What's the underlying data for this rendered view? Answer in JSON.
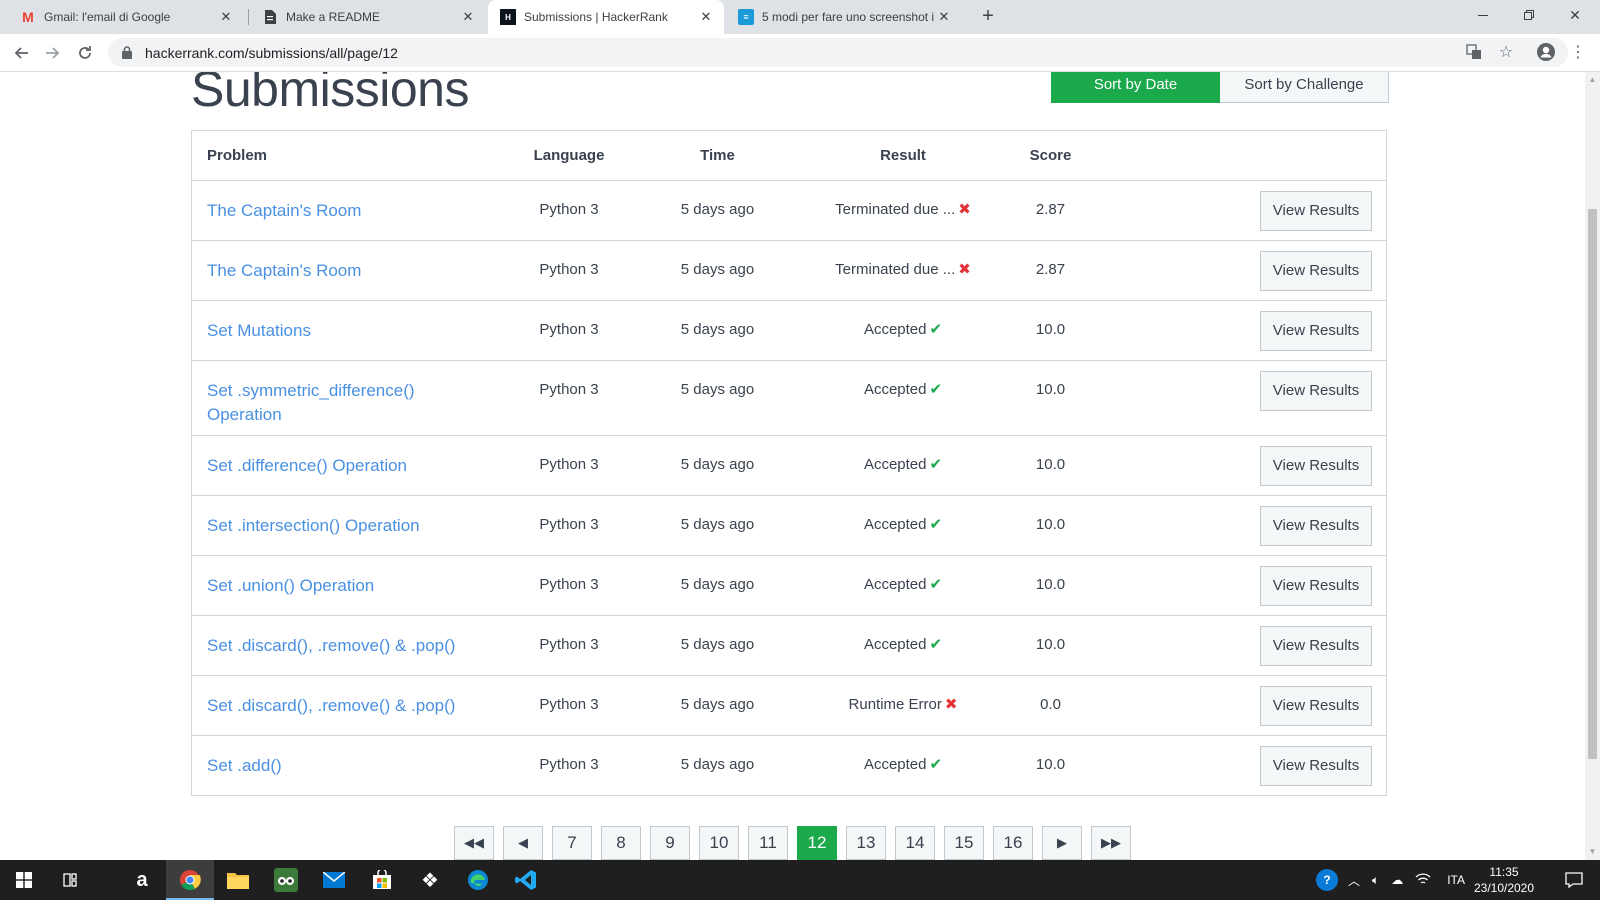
{
  "browser": {
    "tabs": [
      {
        "title": "Gmail: l'email di Google",
        "icon": "gmail-icon",
        "active": false
      },
      {
        "title": "Make a README",
        "icon": "document-icon",
        "active": false
      },
      {
        "title": "Submissions | HackerRank",
        "icon": "hackerrank-icon",
        "active": true
      },
      {
        "title": "5 modi per fare uno screenshot i",
        "icon": "docs-icon",
        "active": false
      }
    ],
    "url": "hackerrank.com/submissions/all/page/12"
  },
  "page": {
    "title": "Submissions",
    "sort_by_date": "Sort by Date",
    "sort_by_challenge": "Sort by Challenge"
  },
  "table": {
    "headers": {
      "problem": "Problem",
      "language": "Language",
      "time": "Time",
      "result": "Result",
      "score": "Score"
    },
    "rows": [
      {
        "problem": "The Captain's Room",
        "language": "Python 3",
        "time": "5 days ago",
        "result": "Terminated due ...",
        "status": "error",
        "score": "2.87",
        "action": "View Results"
      },
      {
        "problem": "The Captain's Room",
        "language": "Python 3",
        "time": "5 days ago",
        "result": "Terminated due ...",
        "status": "error",
        "score": "2.87",
        "action": "View Results"
      },
      {
        "problem": "Set Mutations",
        "language": "Python 3",
        "time": "5 days ago",
        "result": "Accepted",
        "status": "ok",
        "score": "10.0",
        "action": "View Results"
      },
      {
        "problem": "Set .symmetric_difference() Operation",
        "language": "Python 3",
        "time": "5 days ago",
        "result": "Accepted",
        "status": "ok",
        "score": "10.0",
        "action": "View Results"
      },
      {
        "problem": "Set .difference() Operation",
        "language": "Python 3",
        "time": "5 days ago",
        "result": "Accepted",
        "status": "ok",
        "score": "10.0",
        "action": "View Results"
      },
      {
        "problem": "Set .intersection() Operation",
        "language": "Python 3",
        "time": "5 days ago",
        "result": "Accepted",
        "status": "ok",
        "score": "10.0",
        "action": "View Results"
      },
      {
        "problem": "Set .union() Operation",
        "language": "Python 3",
        "time": "5 days ago",
        "result": "Accepted",
        "status": "ok",
        "score": "10.0",
        "action": "View Results"
      },
      {
        "problem": "Set .discard(), .remove() & .pop()",
        "language": "Python 3",
        "time": "5 days ago",
        "result": "Accepted",
        "status": "ok",
        "score": "10.0",
        "action": "View Results"
      },
      {
        "problem": "Set .discard(), .remove() & .pop()",
        "language": "Python 3",
        "time": "5 days ago",
        "result": "Runtime Error",
        "status": "error",
        "score": "0.0",
        "action": "View Results"
      },
      {
        "problem": "Set .add()",
        "language": "Python 3",
        "time": "5 days ago",
        "result": "Accepted",
        "status": "ok",
        "score": "10.0",
        "action": "View Results"
      }
    ]
  },
  "pagination": {
    "pages": [
      "7",
      "8",
      "9",
      "10",
      "11",
      "12",
      "13",
      "14",
      "15",
      "16"
    ],
    "current": "12"
  },
  "colors": {
    "accent_green": "#1ba94c",
    "link_blue": "#4a90e2",
    "error_red": "#e3343a"
  },
  "taskbar": {
    "apps": [
      "windows-start-icon",
      "task-view-icon",
      "amazon-icon",
      "chrome-icon",
      "file-explorer-icon",
      "tripadvisor-icon",
      "mail-icon",
      "store-icon",
      "dropbox-icon",
      "edge-icon",
      "vscode-icon"
    ],
    "language": "ITA",
    "time": "11:35",
    "date": "23/10/2020"
  }
}
